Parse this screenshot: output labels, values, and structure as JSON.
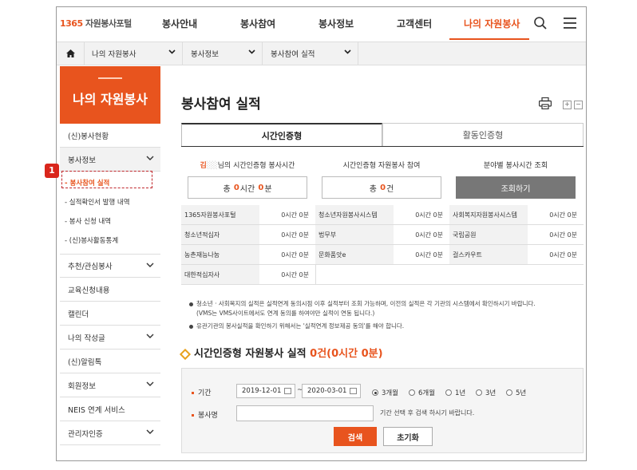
{
  "topnav": {
    "logo_num": "1365",
    "logo_text": "자원봉사포털",
    "items": [
      "봉사안내",
      "봉사참여",
      "봉사정보",
      "고객센터",
      "나의 자원봉사"
    ]
  },
  "breadcrumb": {
    "items": [
      "나의 자원봉사",
      "봉사정보",
      "봉사참여 실적"
    ]
  },
  "sidebar": {
    "title": "나의 자원봉사",
    "items": [
      "(신)봉사현황",
      "봉사정보",
      "추천/관심봉사",
      "교육신청내용",
      "캘린더",
      "나의 작성글",
      "(신)알림톡",
      "회원정보",
      "NEIS 연계 서비스",
      "관리자인증"
    ],
    "sub_items": [
      "봉사참여 실적",
      "실적확인서 발행 내역",
      "봉사 신청 내역",
      "(신)봉사활동통계"
    ]
  },
  "callout_label": "1",
  "main": {
    "title": "봉사참여 실적",
    "tabs": [
      "시간인증형",
      "활동인증형"
    ],
    "panel": {
      "user_prefix": "김",
      "user_suffix": "님의 시간인증형 봉사시간",
      "label2": "시간인증형 자원봉사 참여",
      "label3": "분야별 봉사시간 조회",
      "total_prefix": "총 ",
      "total_hours": "0",
      "total_hour_unit": "시간 ",
      "total_minutes": "0",
      "total_minute_unit": "분",
      "count_prefix": "총 ",
      "count": "0",
      "count_unit": "건",
      "lookup_button": "조회하기"
    },
    "grid": [
      {
        "name": "1365자원봉사포털",
        "value": "0시간 0분"
      },
      {
        "name": "청소년자원봉사시스템",
        "value": "0시간 0분"
      },
      {
        "name": "사회복지자원봉사시스템",
        "value": "0시간 0분"
      },
      {
        "name": "청소년적십자",
        "value": "0시간 0분"
      },
      {
        "name": "법무부",
        "value": "0시간 0분"
      },
      {
        "name": "국립공원",
        "value": "0시간 0분"
      },
      {
        "name": "농촌재능나눔",
        "value": "0시간 0분"
      },
      {
        "name": "문화품앗e",
        "value": "0시간 0분"
      },
      {
        "name": "걸스카우트",
        "value": "0시간 0분"
      },
      {
        "name": "대한적십자사",
        "value": "0시간 0분"
      }
    ],
    "notes": [
      "청소년 · 사회복지의 실적은 실적연계 동의시점 이후 실적부터 조회 가능하며, 이전의 실적은 각 기관의 시스템에서 확인하시기 바랍니다.",
      "(VMS는 VMS사이트에서도 연계 동의를 하여야만 실적이 연동 됩니다.)",
      "유관기관의 봉사실적을 확인하기 위해서는 '실적연계 정보제공 동의'를 해야 합니다."
    ],
    "section": {
      "title": "시간인증형 자원봉사 실적",
      "summary": "0건(0시간 0분)"
    },
    "filter": {
      "period_label": "기간",
      "start_date": "2019-12-01",
      "tilde": "~",
      "end_date": "2020-03-01",
      "periods": [
        "3개월",
        "6개월",
        "1년",
        "3년",
        "5년"
      ],
      "selected_period": "3개월",
      "name_label": "봉사명",
      "name_value": "",
      "hint": "기간 선택 후 검색 하시기 바랍니다.",
      "search_button": "검색",
      "reset_button": "초기화"
    }
  },
  "colors": {
    "accent": "#e8541e",
    "callout": "#d9261c",
    "dark_button": "#777777"
  }
}
